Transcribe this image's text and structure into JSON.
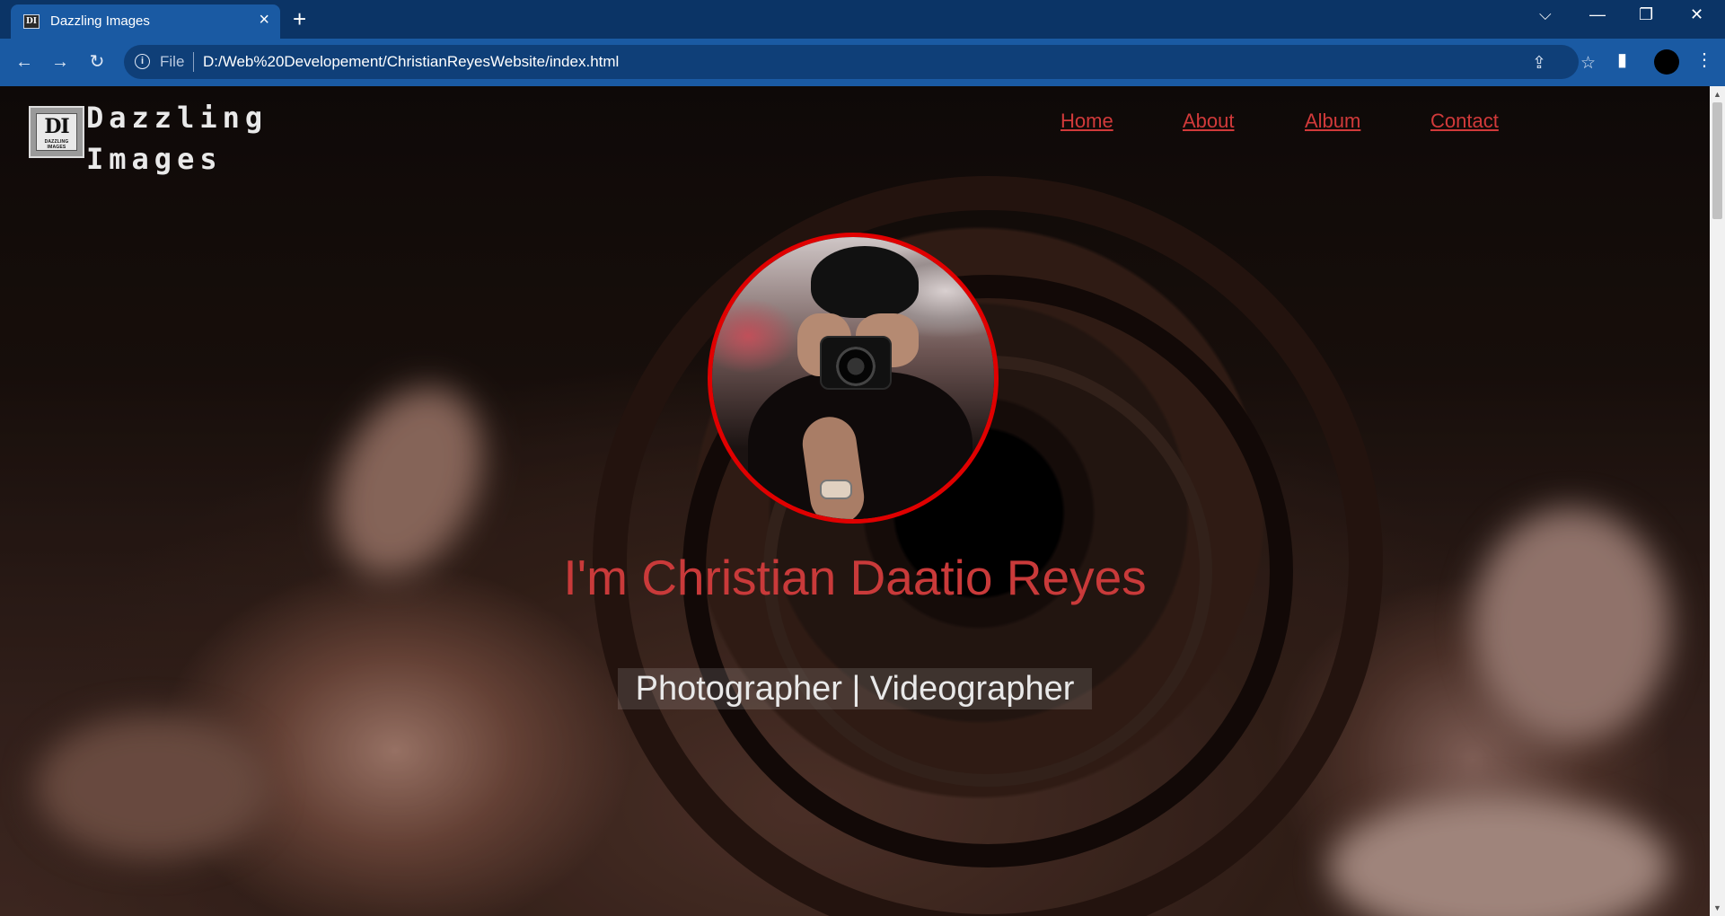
{
  "browser": {
    "tab_title": "Dazzling Images",
    "tab_favicon_text": "DI",
    "file_label": "File",
    "url": "D:/Web%20Developement/ChristianReyesWebsite/index.html",
    "icons": {
      "back": "arrow-left-icon",
      "forward": "arrow-right-icon",
      "reload": "reload-icon",
      "info": "info-icon",
      "share": "share-icon",
      "bookmark": "star-icon",
      "side_panel": "side-panel-icon",
      "menu": "kebab-menu-icon",
      "tab_search": "chevron-down-icon",
      "minimize": "minimize-icon",
      "restore": "restore-icon",
      "close": "close-icon"
    },
    "colors": {
      "tabbar": "#0b3466",
      "toolbar": "#1a5aa3"
    }
  },
  "site": {
    "logo_monogram": "DI",
    "logo_small_text": "DAZZLING IMAGES",
    "brand_line1": "Dazzling",
    "brand_line2": "Images",
    "nav": [
      {
        "label": "Home"
      },
      {
        "label": "About"
      },
      {
        "label": "Album"
      },
      {
        "label": "Contact"
      }
    ],
    "hero": {
      "headline": "I'm Christian Daatio Reyes",
      "subtitle": "Photographer | Videographer"
    },
    "colors": {
      "accent": "#d13a3a",
      "avatar_border": "#e00000"
    }
  }
}
